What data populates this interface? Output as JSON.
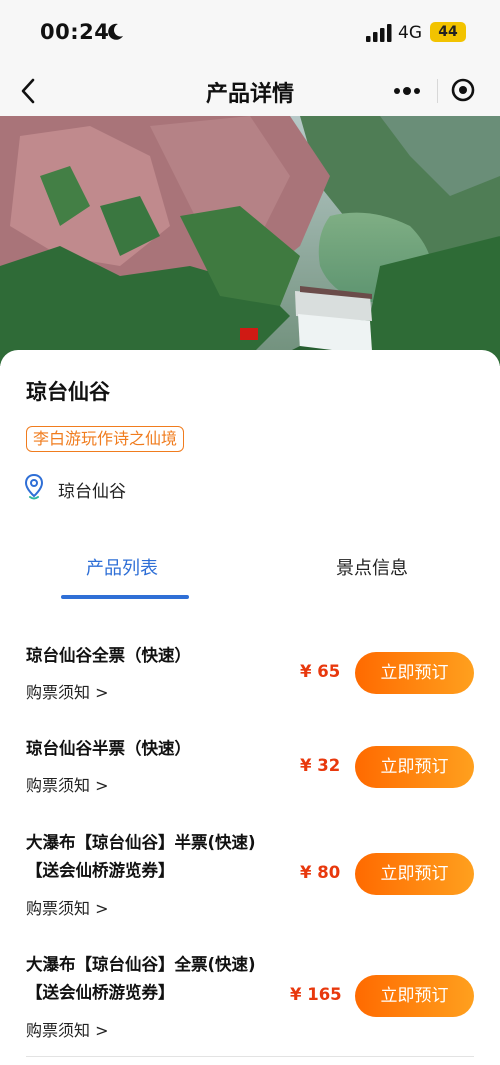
{
  "status_bar": {
    "time": "00:24",
    "network": "4G",
    "battery": "44"
  },
  "nav": {
    "title": "产品详情"
  },
  "spot": {
    "title": "琼台仙谷",
    "tagline": "李白游玩作诗之仙境",
    "location": "琼台仙谷"
  },
  "tabs": [
    {
      "label": "产品列表",
      "active": true
    },
    {
      "label": "景点信息",
      "active": false
    }
  ],
  "products": [
    {
      "name_lines": [
        "琼台仙谷全票（快速）"
      ],
      "notice": "购票须知 >",
      "price": "¥ 65",
      "button": "立即预订"
    },
    {
      "name_lines": [
        "琼台仙谷半票（快速）"
      ],
      "notice": "购票须知 >",
      "price": "¥ 32",
      "button": "立即预订"
    },
    {
      "name_lines": [
        "大瀑布【琼台仙谷】半票(快速)",
        "【送会仙桥游览券】"
      ],
      "notice": "购票须知 >",
      "price": "¥ 80",
      "button": "立即预订"
    },
    {
      "name_lines": [
        "大瀑布【琼台仙谷】全票(快速)",
        "【送会仙桥游览券】"
      ],
      "notice": "购票须知 >",
      "price": "¥ 165",
      "button": "立即预订"
    }
  ],
  "colors": {
    "accent_blue": "#2f6fd6",
    "price_red": "#e8380d",
    "button_orange": "#ff6a00",
    "tag_orange": "#f07c1e"
  }
}
